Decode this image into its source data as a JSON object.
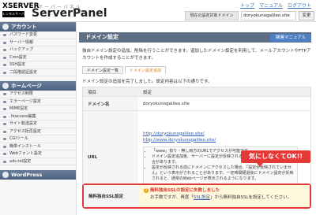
{
  "header": {
    "logo_text": "XSERVER",
    "logo_badge": "レンタルサーバー",
    "logo_kana": "サーバーパネル",
    "app_name": "ServerPanel",
    "top_links": [
      "トップ",
      "マニュアル",
      "ログアウト"
    ],
    "domain_label": "現在の設定対象ドメイン",
    "domain_value": "doryokunogalileo.site",
    "change_label": "変更"
  },
  "sidebar": {
    "sections": [
      {
        "title": "アカウント",
        "items": [
          "パスワード変更",
          "サーバー情報",
          "バックアップ",
          "Cron設定",
          "SSH設定",
          "二段階認証設定"
        ]
      },
      {
        "title": "ホームページ",
        "items": [
          "アクセス制限",
          "エラーページ設定",
          "MIME設定",
          ".htaccess編集",
          "サイト転送設定",
          "アクセス拒否設定",
          "CGIツール",
          "簡単インストール",
          "Webフォント設定",
          "ads.txt設定"
        ]
      },
      {
        "title": "WordPress",
        "items": []
      }
    ]
  },
  "main": {
    "manual_button": "関連マニュアル",
    "section_title": "ドメイン設定",
    "intro": "独自ドメイン設定の追加、削除を行うことができます。追加したドメイン設定を利用して、メールアカウントやFTPアカウントを作成することができます。",
    "tabs": [
      {
        "label": "ドメイン設定一覧",
        "active": false
      },
      {
        "label": "ドメイン設定追加",
        "active": true
      }
    ],
    "note": "ドメイン設定の追加を完了しました。設定内容は以下の通りです。",
    "table": {
      "head": {
        "k": "項目",
        "v": "設定"
      },
      "domain_label": "ドメイン名",
      "domain_value": "doryokunogalileo.site",
      "url_label": "URL",
      "urls": [
        "http://doryokunogalileo.site/",
        "http://www.doryokunogalileo.site/"
      ],
      "url_notes": [
        "「www」有り・無し両方のURLでアクセスが可能です。",
        "ドメイン設定追加後、サーバーに設定が反映されるまで最大1時間程度かかる場合があります。",
        "設定が反映される前にドメインにアクセスした場合、「設定が反映されていません」という表示がされることがあります。一定時間経過後にドメイン設定が反映されると、通常のWebページが表示されるようになります。"
      ],
      "ssl_label": "無料独自SSL設定",
      "ssl_warning_title": "無料独自SSLの設定に失敗しました",
      "ssl_warning_body_pre": "お手数ですが、再度「",
      "ssl_warning_link": "SSL設定",
      "ssl_warning_body_post": "」から無料独自SSLを設定してください。"
    }
  },
  "annotation": {
    "callout": "気にしなくてOK!!"
  },
  "colors": {
    "nav_header": "#5e6f85",
    "accent_orange": "#e07b16",
    "callout_red": "#e53935",
    "link_blue": "#2a5db0"
  }
}
